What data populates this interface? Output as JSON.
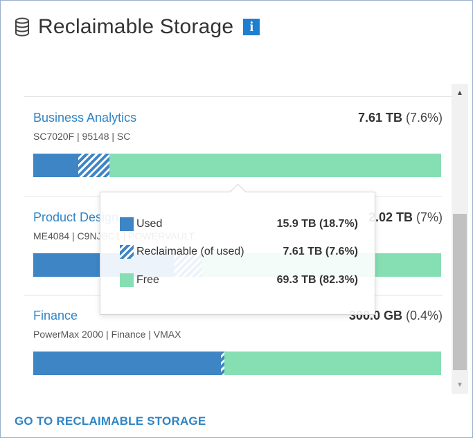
{
  "header": {
    "title": "Reclaimable Storage",
    "info_badge": "i"
  },
  "items": [
    {
      "name": "Business Analytics",
      "meta": "SC7020F | 95148 | SC",
      "amount": "7.61 TB",
      "percent": "(7.6%)",
      "bar": {
        "used_fraction": 0.11,
        "reclaimable_fraction": 0.076,
        "free_fraction": 0.814
      }
    },
    {
      "name": "Product Design",
      "meta": "ME4084 | C9NJBC1 | POWERVAULT",
      "amount": "2.02 TB",
      "percent": "(7%)",
      "bar": {
        "used_fraction": 0.345,
        "reclaimable_fraction": 0.07,
        "free_fraction": 0.585
      }
    },
    {
      "name": "Finance",
      "meta": "PowerMax 2000 | Finance | VMAX",
      "amount": "300.0 GB",
      "percent": "(0.4%)",
      "bar": {
        "used_fraction": 0.46,
        "reclaimable_fraction": 0.008,
        "free_fraction": 0.532
      }
    }
  ],
  "tooltip": {
    "rows": [
      {
        "label": "Used",
        "value": "15.9 TB (18.7%)",
        "swatch": "used"
      },
      {
        "label": "Reclaimable (of used)",
        "value": "7.61 TB (7.6%)",
        "swatch": "reclaimable"
      },
      {
        "label": "Free",
        "value": "69.3 TB (82.3%)",
        "swatch": "free"
      }
    ]
  },
  "footer": {
    "link": "GO TO RECLAIMABLE STORAGE"
  },
  "colors": {
    "used": "#3e85c6",
    "free": "#86dfb3",
    "link": "#2f84c5",
    "badge": "#1e7fd0"
  },
  "icons": {
    "header": "database-icon",
    "scroll_up": "scroll-up-arrow-icon",
    "scroll_down": "scroll-down-arrow-icon"
  }
}
